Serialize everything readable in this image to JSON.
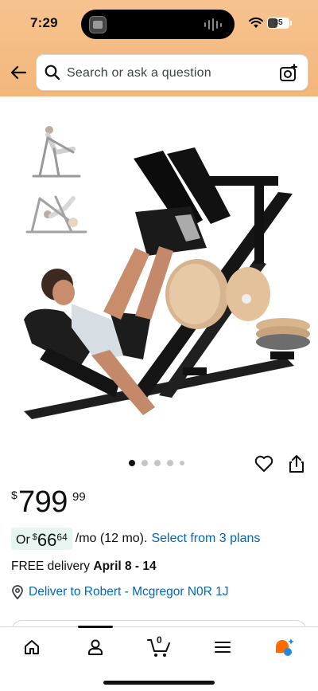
{
  "status_bar": {
    "time": "7:29",
    "battery": "35"
  },
  "search": {
    "placeholder": "Search or ask a question"
  },
  "gallery": {
    "dots_count": 5,
    "active_dot": 0
  },
  "price": {
    "currency": "$",
    "whole": "799",
    "fraction": "99"
  },
  "installment": {
    "prefix": "Or",
    "currency": "$",
    "whole": "66",
    "fraction": "64",
    "suffix": "/mo (12 mo).",
    "link": "Select from 3 plans"
  },
  "delivery": {
    "label": "FREE delivery",
    "dates": "April 8 - 14"
  },
  "location": {
    "text": "Deliver to Robert - Mcgregor N0R 1J"
  },
  "nav": {
    "cart_count": "0",
    "items": [
      "home-icon",
      "account-icon",
      "cart-icon",
      "menu-icon",
      "rufus-icon"
    ]
  },
  "colors": {
    "header": "#f3b67a",
    "link": "#0066c0",
    "plan_bg": "#e6f5ef"
  }
}
